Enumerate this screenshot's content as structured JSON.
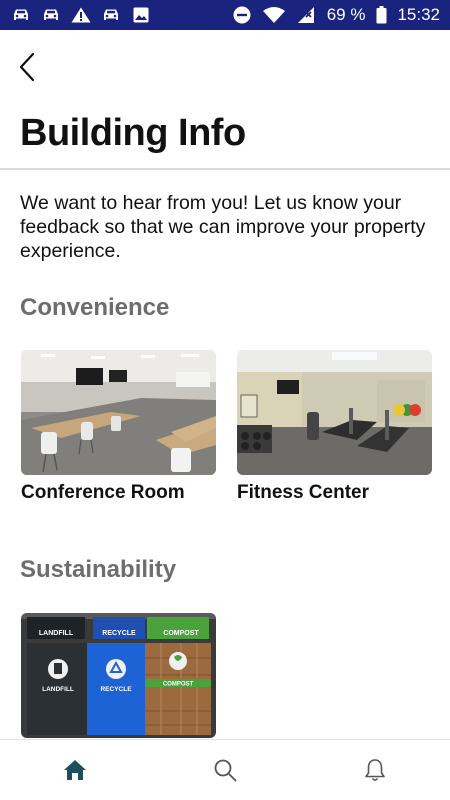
{
  "status_bar": {
    "battery_percent": "69 %",
    "time": "15:32",
    "icons": [
      "car-icon",
      "car-icon",
      "warning-icon",
      "car-icon",
      "image-icon",
      "do-not-disturb-icon",
      "wifi-icon",
      "no-signal-icon",
      "battery-icon"
    ]
  },
  "header": {
    "back_icon": "chevron-left-icon",
    "title": "Building Info"
  },
  "intro": {
    "text": "We want to hear from you! Let us know your feedback so that we can improve your property experience."
  },
  "sections": [
    {
      "title": "Convenience",
      "cards": [
        {
          "label": "Conference Room"
        },
        {
          "label": "Fitness Center"
        }
      ]
    },
    {
      "title": "Sustainability",
      "cards": [
        {
          "label": "",
          "image_text": {
            "landfill_top": "LANDFILL",
            "recycle_top": "RECYCLE",
            "compost_top": "COMPOST",
            "landfill_bin": "LANDFILL",
            "recycle_bin": "RECYCLE",
            "compost_bin": "COMPOST"
          }
        }
      ]
    }
  ],
  "bottom_nav": {
    "items": [
      {
        "icon": "home-icon",
        "active": true
      },
      {
        "icon": "search-icon",
        "active": false
      },
      {
        "icon": "bell-icon",
        "active": false
      }
    ]
  },
  "colors": {
    "status_bar": "#1a237e",
    "section_title": "#6d6d6d",
    "nav_active": "#1f4f5c",
    "nav_inactive": "#555555"
  }
}
